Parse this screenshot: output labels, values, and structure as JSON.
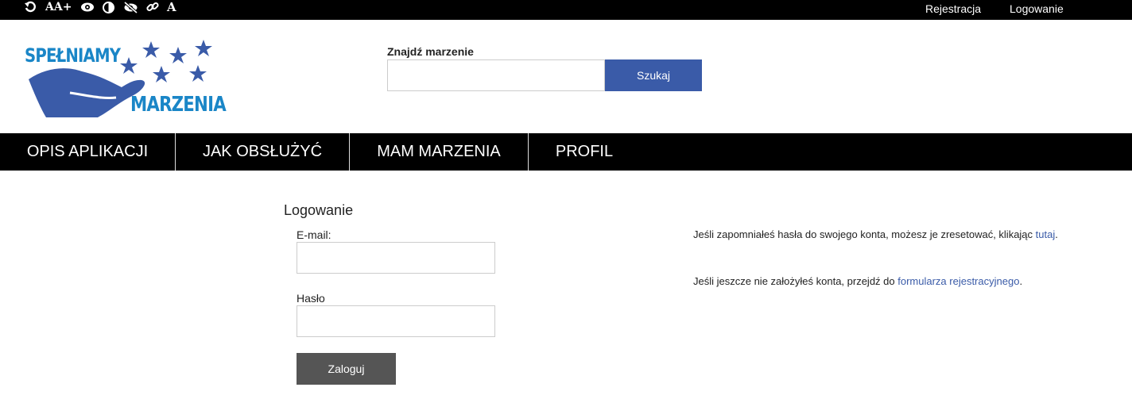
{
  "topbar": {
    "a11y": [
      {
        "name": "reset-icon"
      },
      {
        "name": "font-size-icon",
        "text": "AA+"
      },
      {
        "name": "eye-icon"
      },
      {
        "name": "contrast-icon"
      },
      {
        "name": "hide-images-icon"
      },
      {
        "name": "link-icon"
      },
      {
        "name": "font-icon",
        "text": "A"
      }
    ],
    "register_label": "Rejestracja",
    "login_label": "Logowanie"
  },
  "logo": {
    "line1": "SPEŁNIAMY",
    "line2": "MARZENIA"
  },
  "search": {
    "label": "Znajdź marzenie",
    "value": "",
    "button_label": "Szukaj"
  },
  "nav": {
    "items": [
      {
        "label": "OPIS APLIKACJI"
      },
      {
        "label": "JAK OBSŁUŻYĆ"
      },
      {
        "label": "MAM MARZENIA"
      },
      {
        "label": "PROFIL"
      }
    ]
  },
  "login": {
    "title": "Logowanie",
    "email_label": "E-mail:",
    "email_value": "",
    "password_label": "Hasło",
    "password_value": "",
    "submit_label": "Zaloguj"
  },
  "info": {
    "reset_text": "Jeśli zapomniałeś hasła do swojego konta, możesz je zresetować, klikając",
    "reset_link": "tutaj",
    "reset_end": ".",
    "register_text": "Jeśli jeszcze nie założyłeś konta, przejdź do",
    "register_link": "formularza rejestracyjnego",
    "register_end": "."
  },
  "colors": {
    "brand_blue": "#3a5ba8",
    "logo_text": "#1a86c7",
    "bar_black": "#000000",
    "button_gray": "#555555"
  }
}
